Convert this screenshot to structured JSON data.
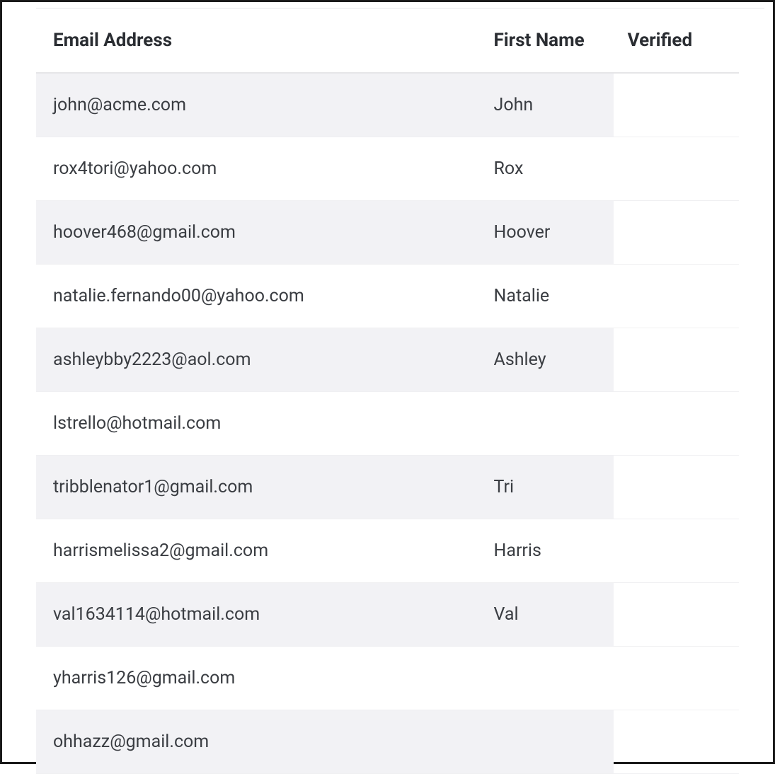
{
  "table": {
    "columns": {
      "email": "Email Address",
      "first_name": "First Name",
      "verified": "Verified"
    },
    "rows": [
      {
        "email": "john@acme.com",
        "first_name": "John",
        "verified": ""
      },
      {
        "email": "rox4tori@yahoo.com",
        "first_name": "Rox",
        "verified": ""
      },
      {
        "email": "hoover468@gmail.com",
        "first_name": "Hoover",
        "verified": ""
      },
      {
        "email": "natalie.fernando00@yahoo.com",
        "first_name": "Natalie",
        "verified": ""
      },
      {
        "email": "ashleybby2223@aol.com",
        "first_name": "Ashley",
        "verified": ""
      },
      {
        "email": "lstrello@hotmail.com",
        "first_name": "",
        "verified": ""
      },
      {
        "email": "tribblenator1@gmail.com",
        "first_name": "Tri",
        "verified": ""
      },
      {
        "email": "harrismelissa2@gmail.com",
        "first_name": "Harris",
        "verified": ""
      },
      {
        "email": "val1634114@hotmail.com",
        "first_name": "Val",
        "verified": ""
      },
      {
        "email": "yharris126@gmail.com",
        "first_name": "",
        "verified": ""
      },
      {
        "email": "ohhazz@gmail.com",
        "first_name": "",
        "verified": ""
      }
    ]
  }
}
